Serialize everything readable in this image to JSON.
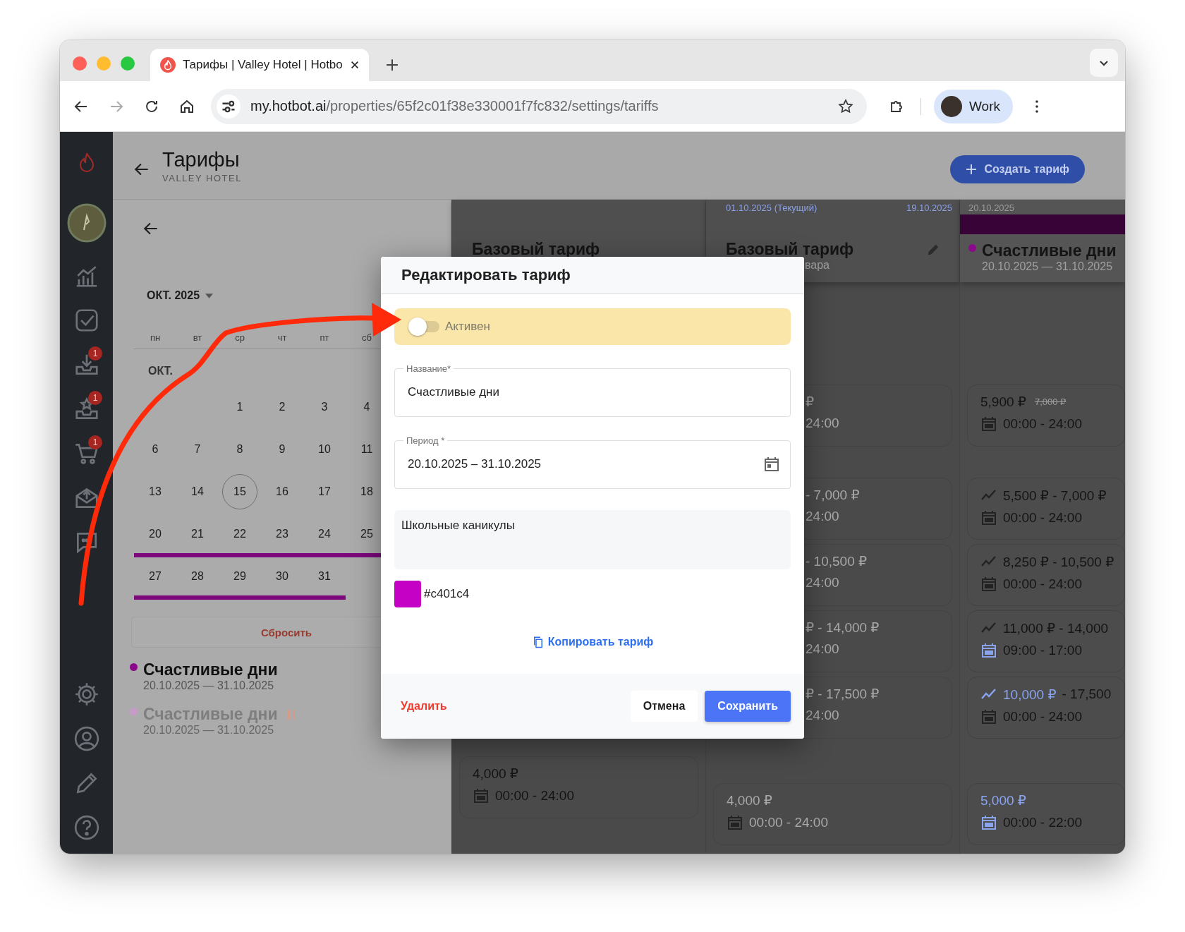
{
  "browser": {
    "tabs": [
      {
        "title": "Тарифы | Valley Hotel | Hotbo",
        "selected": true
      }
    ],
    "url_host": "my.hotbot.ai",
    "url_path": "/properties/65f2c01f38e330001f7fc832/settings/tariffs",
    "profile": "Work"
  },
  "sidebar": {
    "top": [
      {
        "kind": "chart"
      },
      {
        "kind": "check"
      },
      {
        "kind": "inbox",
        "badge": "1"
      },
      {
        "kind": "reviews",
        "badge": "1"
      },
      {
        "kind": "cart",
        "badge": "1"
      },
      {
        "kind": "mail"
      },
      {
        "kind": "chat"
      }
    ],
    "bottom": [
      {
        "kind": "settings"
      },
      {
        "kind": "user"
      },
      {
        "kind": "pencil"
      },
      {
        "kind": "help"
      }
    ]
  },
  "header": {
    "title": "Тарифы",
    "subtitle": "VALLEY HOTEL",
    "create_button": "Создать тариф"
  },
  "calendar": {
    "month": "ОКТ. 2025",
    "weekdays": [
      "пн",
      "вт",
      "ср",
      "чт",
      "пт",
      "сб"
    ],
    "section": "ОКТ.",
    "reset": "Сбросить",
    "weeks": [
      {
        "days": [
          {
            "kind": "empty"
          },
          {
            "kind": "empty"
          },
          {
            "kind": "day",
            "label": "1",
            "today": false,
            "in_range": false
          },
          {
            "kind": "day",
            "label": "2",
            "today": false,
            "in_range": false
          },
          {
            "kind": "day",
            "label": "3",
            "today": false,
            "in_range": false
          },
          {
            "kind": "day",
            "label": "4",
            "today": false,
            "in_range": false
          }
        ]
      },
      {
        "days": [
          {
            "kind": "day",
            "label": "6",
            "today": false,
            "in_range": false
          },
          {
            "kind": "day",
            "label": "7",
            "today": false,
            "in_range": false
          },
          {
            "kind": "day",
            "label": "8",
            "today": false,
            "in_range": false
          },
          {
            "kind": "day",
            "label": "9",
            "today": false,
            "in_range": false
          },
          {
            "kind": "day",
            "label": "10",
            "today": false,
            "in_range": false
          },
          {
            "kind": "day",
            "label": "11",
            "today": false,
            "in_range": false
          }
        ]
      },
      {
        "days": [
          {
            "kind": "day",
            "label": "13",
            "today": false,
            "in_range": false
          },
          {
            "kind": "day",
            "label": "14",
            "today": false,
            "in_range": false
          },
          {
            "kind": "day",
            "label": "15",
            "today": true,
            "in_range": false
          },
          {
            "kind": "day",
            "label": "16",
            "today": false,
            "in_range": false
          },
          {
            "kind": "day",
            "label": "17",
            "today": false,
            "in_range": false
          },
          {
            "kind": "day",
            "label": "18",
            "today": false,
            "in_range": false
          }
        ]
      },
      {
        "days": [
          {
            "kind": "day",
            "label": "20",
            "today": false,
            "in_range": true
          },
          {
            "kind": "day",
            "label": "21",
            "today": false,
            "in_range": true
          },
          {
            "kind": "day",
            "label": "22",
            "today": false,
            "in_range": true
          },
          {
            "kind": "day",
            "label": "23",
            "today": false,
            "in_range": true
          },
          {
            "kind": "day",
            "label": "24",
            "today": false,
            "in_range": true
          },
          {
            "kind": "day",
            "label": "25",
            "today": false,
            "in_range": true
          }
        ]
      },
      {
        "days": [
          {
            "kind": "day",
            "label": "27",
            "today": false,
            "in_range": true
          },
          {
            "kind": "day",
            "label": "28",
            "today": false,
            "in_range": true
          },
          {
            "kind": "day",
            "label": "29",
            "today": false,
            "in_range": true
          },
          {
            "kind": "day",
            "label": "30",
            "today": false,
            "in_range": true
          },
          {
            "kind": "day",
            "label": "31",
            "today": false,
            "in_range": true
          }
        ]
      }
    ]
  },
  "legend": [
    {
      "name": "Счастливые дни",
      "dates": "20.10.2025 — 31.10.2025",
      "color": "#8b0a8b",
      "paused": false
    },
    {
      "name": "Счастливые дни",
      "dates": "20.10.2025 — 31.10.2025",
      "color": "#c79bc7",
      "paused": true
    }
  ],
  "columns": [
    {
      "title": "Базовый тариф",
      "muted": false,
      "cards": [
        {
          "kind": "full",
          "trend": false,
          "parts": [
            {
              "text": "4,000 ₽",
              "accent": false
            }
          ],
          "time": "00:00 - 24:00",
          "time_accent": false
        }
      ]
    },
    {
      "date": "01.10.2025 (Текущий)",
      "date_end": "19.10.2025",
      "current": true,
      "title": "Базовый тариф",
      "subtitle": "вара",
      "editable": true,
      "muted": true,
      "cards": [
        {
          "kind": "partial",
          "parts": [
            {
              "text": "₽",
              "accent": false
            }
          ],
          "time": "24:00"
        },
        {
          "kind": "partial",
          "parts": [
            {
              "text": "- 7,000 ₽",
              "accent": false
            }
          ],
          "time": "24:00"
        },
        {
          "kind": "partial",
          "parts": [
            {
              "text": "- 10,500 ₽",
              "accent": false
            }
          ],
          "time": "24:00"
        },
        {
          "kind": "partial",
          "parts": [
            {
              "text": "₽ - 14,000 ₽",
              "accent": false
            }
          ],
          "time": "24:00"
        },
        {
          "kind": "partial",
          "parts": [
            {
              "text": "₽ - 17,500 ₽",
              "accent": false
            }
          ],
          "time": "24:00"
        },
        {
          "kind": "full",
          "trend": false,
          "parts": [
            {
              "text": "4,000 ₽",
              "accent": false
            }
          ],
          "time": "00:00 - 24:00",
          "time_accent": false
        }
      ]
    },
    {
      "date": "20.10.2025",
      "current": false,
      "color": "#8b0a8b",
      "title": "Счастливые дни",
      "subtitle": "20.10.2025 — 31.10.2025",
      "muted": false,
      "cards": [
        {
          "kind": "full",
          "trend": false,
          "parts": [
            {
              "text": "5,900 ₽",
              "accent": false
            }
          ],
          "old_price": "7,000 ₽",
          "time": "00:00 - 24:00",
          "time_accent": false
        },
        {
          "kind": "full",
          "trend": true,
          "parts": [
            {
              "text": "5,500 ₽ - 7,000 ₽",
              "accent": false
            }
          ],
          "time": "00:00 - 24:00",
          "time_accent": false
        },
        {
          "kind": "full",
          "trend": true,
          "parts": [
            {
              "text": "8,250 ₽ - 10,500 ₽",
              "accent": false
            }
          ],
          "time": "00:00 - 24:00",
          "time_accent": false
        },
        {
          "kind": "full",
          "trend": true,
          "parts": [
            {
              "text": "11,000 ₽ - 14,000",
              "accent": false
            }
          ],
          "time": "09:00 - 17:00",
          "time_accent": true
        },
        {
          "kind": "full",
          "trend": true,
          "parts": [
            {
              "text": "10,000 ₽",
              "accent": true
            },
            {
              "text": "- 17,500",
              "accent": false
            }
          ],
          "time": "00:00 - 24:00",
          "time_accent": false
        },
        {
          "kind": "full",
          "trend": false,
          "parts": [
            {
              "text": "5,000 ₽",
              "accent": true
            }
          ],
          "time": "00:00 - 22:00",
          "time_accent": true
        }
      ]
    }
  ],
  "dialog": {
    "title": "Редактировать тариф",
    "active_label": "Активен",
    "active": false,
    "name_label": "Название*",
    "name_value": "Счастливые дни",
    "period_label": "Период *",
    "period_value": "20.10.2025 – 31.10.2025",
    "description": "Школьные каникулы",
    "color": "#c401c4",
    "color_text": "#c401c4",
    "copy_link": "Копировать тариф",
    "delete": "Удалить",
    "cancel": "Отмена",
    "save": "Сохранить"
  }
}
